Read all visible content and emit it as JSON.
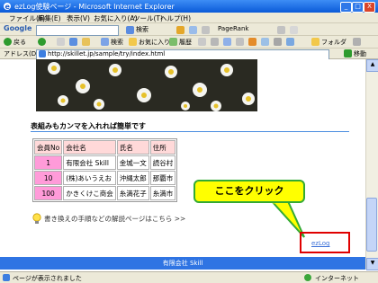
{
  "window": {
    "title": "ezLog使験ページ - Microsoft Internet Explorer",
    "min": "_",
    "max": "□",
    "close": "X"
  },
  "menu": [
    "ファイル(F)",
    "編集(E)",
    "表示(V)",
    "お気に入り(A)",
    "ツール(T)",
    "ヘルプ(H)"
  ],
  "google_bar": {
    "brand": "Google",
    "search": "検索",
    "options": [
      "PageRank"
    ]
  },
  "nav": {
    "back": "戻る",
    "search": "検索",
    "favorites": "お気に入り",
    "history": "履歴",
    "folder": "フォルダ"
  },
  "address": {
    "label": "アドレス(D)",
    "url": "http://skillet.jp/sample/try/index.html",
    "go": "移動"
  },
  "content": {
    "heading": "表組みもカンマを入れれば簡単です",
    "table": {
      "headers": [
        "会員No",
        "会社名",
        "氏名",
        "住所"
      ],
      "rows": [
        [
          "1",
          "有限会社 Skill",
          "金城一文",
          "読谷村"
        ],
        [
          "10",
          "(株)あいうえお",
          "沖縄太郎",
          "那覇市"
        ],
        [
          "100",
          "かきくけこ商会",
          "糸満花子",
          "糸満市"
        ]
      ]
    },
    "guide_link": "書き換えの手順などの解説ページはこちら >>",
    "callout": "ここをクリック",
    "redbox_link": "ezLog",
    "footer": "有限会社 Skill"
  },
  "status": {
    "left": "ページが表示されました",
    "right": "インターネット"
  },
  "colors": {
    "title_blue": "#0a5ad8",
    "footer_blue": "#2f74e3",
    "callout_yellow": "#ffff00",
    "highlight_red": "#e00000",
    "pink_cell": "#ff9bd9"
  }
}
